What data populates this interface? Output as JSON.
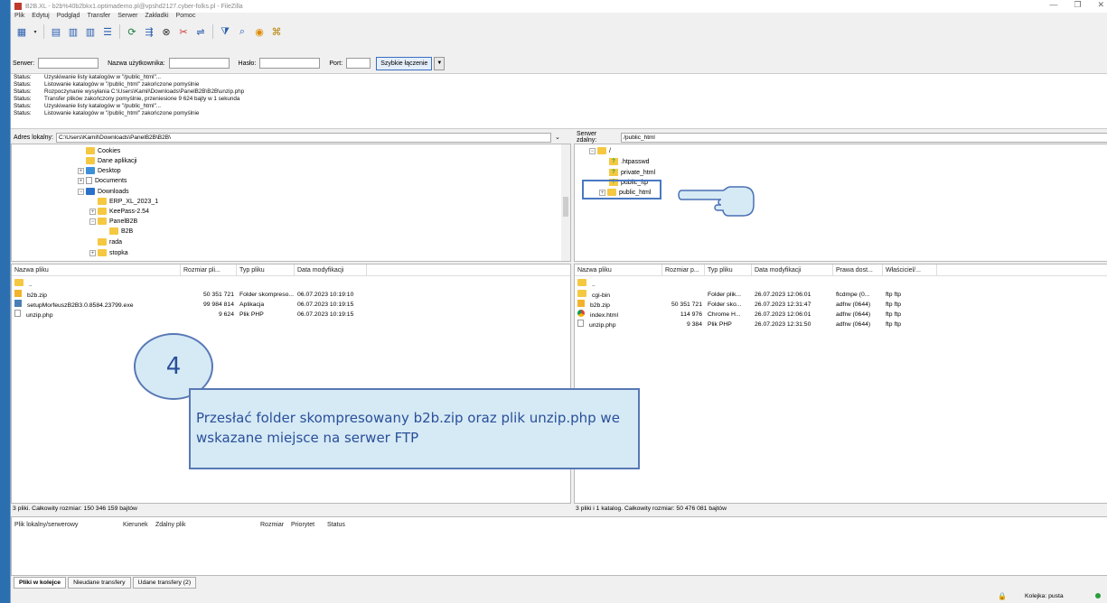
{
  "window": {
    "title": "B2B.XL - b2b%40b2bkx1.optimademo.pl@vpshd2127.cyber-folks.pl - FileZilla",
    "controls": [
      "—",
      "❐",
      "✕"
    ]
  },
  "menu": [
    "Plik",
    "Edytuj",
    "Podgląd",
    "Transfer",
    "Serwer",
    "Zakładki",
    "Pomoc"
  ],
  "quickconnect": {
    "server_label": "Serwer:",
    "user_label": "Nazwa użytkownika:",
    "pass_label": "Hasło:",
    "port_label": "Port:",
    "button": "Szybkie łączenie"
  },
  "log": [
    {
      "s": "Status:",
      "m": "Uzyskiwanie listy katalogów w \"/public_html\"..."
    },
    {
      "s": "Status:",
      "m": "Listowanie katalogów w \"/public_html\" zakończone pomyślnie"
    },
    {
      "s": "Status:",
      "m": "Rozpoczynanie wysyłania C:\\Users\\Kamil\\Downloads\\PanelB2B\\B2B\\unzip.php"
    },
    {
      "s": "Status:",
      "m": "Transfer plików zakończony pomyślnie, przeniesione 9 624 bajty w 1 sekunda"
    },
    {
      "s": "Status:",
      "m": "Uzyskiwanie listy katalogów w \"/public_html\"..."
    },
    {
      "s": "Status:",
      "m": "Listowanie katalogów w \"/public_html\" zakończone pomyślnie"
    }
  ],
  "local": {
    "address_label": "Adres lokalny:",
    "address": "C:\\Users\\Kamil\\Downloads\\PanelB2B\\B2B\\",
    "tree": [
      "Cookies",
      "Dane aplikacji",
      "Desktop",
      "Documents",
      "Downloads",
      "ERP_XL_2023_1",
      "KeePass-2.54",
      "PanelB2B",
      "B2B",
      "rada",
      "stopka"
    ],
    "columns": [
      "Nazwa pliku",
      "Rozmiar pli...",
      "Typ pliku",
      "Data modyfikacji"
    ],
    "files": [
      {
        "name": "..",
        "size": "",
        "type": "",
        "date": ""
      },
      {
        "name": "b2b.zip",
        "size": "50 351 721",
        "type": "Folder skompreso...",
        "date": "06.07.2023 10:19:10"
      },
      {
        "name": "setupMorfeuszB2B3.0.8584.23799.exe",
        "size": "99 984 814",
        "type": "Aplikacja",
        "date": "06.07.2023 10:19:15"
      },
      {
        "name": "unzip.php",
        "size": "9 624",
        "type": "Plik PHP",
        "date": "06.07.2023 10:19:15"
      }
    ],
    "status": "3 pliki. Całkowity rozmiar: 150 346 159 bajtów"
  },
  "remote": {
    "address_label": "Serwer zdalny:",
    "address": "/public_html",
    "tree": [
      "/",
      ".htpasswd",
      "private_html",
      "public_ftp",
      "public_html"
    ],
    "columns": [
      "Nazwa pliku",
      "Rozmiar p...",
      "Typ pliku",
      "Data modyfikacji",
      "Prawa dost...",
      "Właściciel/..."
    ],
    "files": [
      {
        "name": "..",
        "size": "",
        "type": "",
        "date": "",
        "perm": "",
        "owner": ""
      },
      {
        "name": "cgi-bin",
        "size": "",
        "type": "Folder plik...",
        "date": "26.07.2023 12:06:01",
        "perm": "flcdmpe (0...",
        "owner": "ftp ftp"
      },
      {
        "name": "b2b.zip",
        "size": "50 351 721",
        "type": "Folder sko...",
        "date": "26.07.2023 12:31:47",
        "perm": "adfrw (0644)",
        "owner": "ftp ftp"
      },
      {
        "name": "index.html",
        "size": "114 976",
        "type": "Chrome H...",
        "date": "26.07.2023 12:06:01",
        "perm": "adfrw (0644)",
        "owner": "ftp ftp"
      },
      {
        "name": "unzip.php",
        "size": "9 384",
        "type": "Plik PHP",
        "date": "26.07.2023 12:31:50",
        "perm": "adfrw (0644)",
        "owner": "ftp ftp"
      }
    ],
    "status": "3 pliki i 1 katalog. Całkowity rozmiar: 50 476 081 bajtów"
  },
  "queue": {
    "columns": [
      "Plik lokalny/serwerowy",
      "Kierunek",
      "Zdalny plik",
      "Rozmiar",
      "Priorytet",
      "Status"
    ],
    "tabs": [
      "Pliki w kolejce",
      "Nieudane transfery",
      "Udane transfery (2)"
    ],
    "queue_status": "Kolejka: pusta"
  },
  "annotation": {
    "step": "4",
    "text": "Przesłać folder skompresowany b2b.zip oraz plik unzip.php we wskazane miejsce na serwer FTP"
  }
}
